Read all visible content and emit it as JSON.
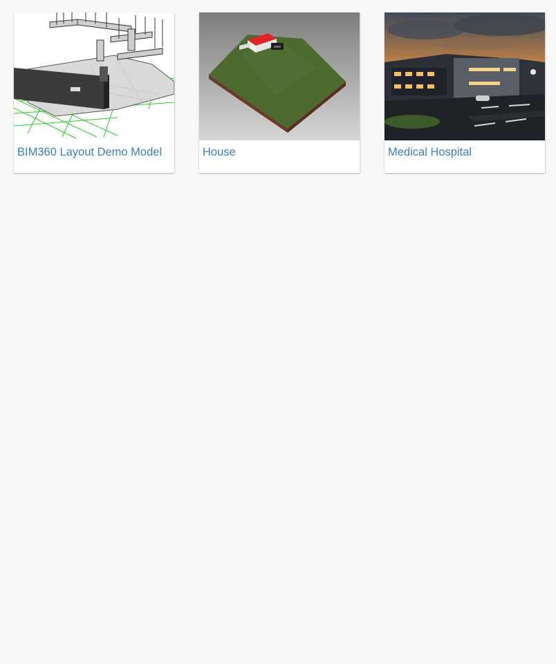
{
  "theme": {
    "background": "#f8f8f8",
    "card_background": "#ffffff",
    "link_color": "#3c7fc1"
  },
  "models": [
    {
      "title": "BIM360 Layout Demo Model",
      "thumbnail": "bim-ductwork-floor-plan"
    },
    {
      "title": "House",
      "thumbnail": "house-on-terrain"
    },
    {
      "title": "Medical Hospital",
      "thumbnail": "hospital-night-render"
    }
  ]
}
